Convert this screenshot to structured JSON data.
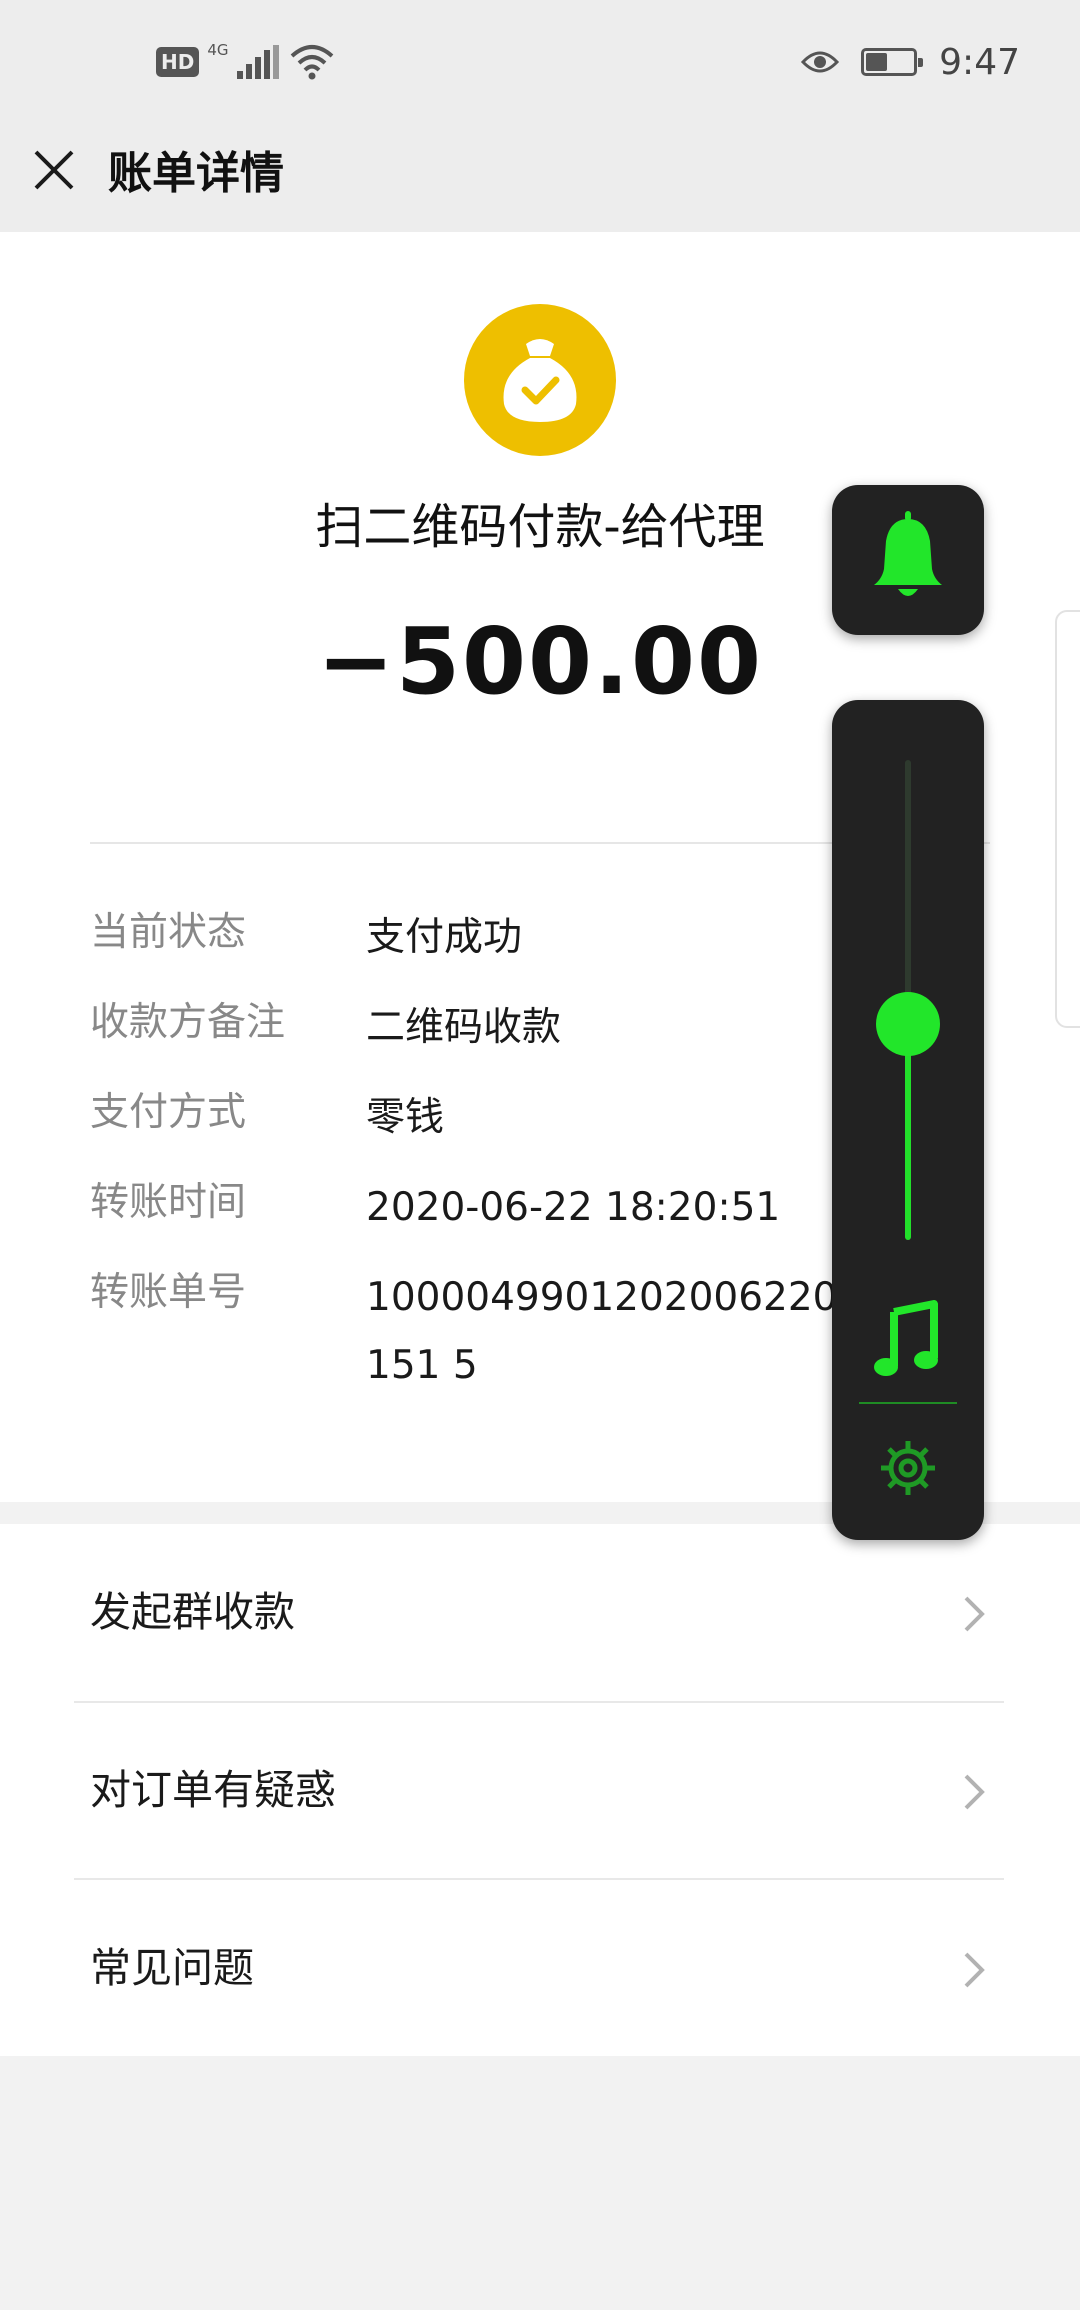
{
  "status_bar": {
    "hd_badge": "HD",
    "network_label": "4G",
    "time": "9:47",
    "battery_level": 0.45,
    "icons": [
      "hd-icon",
      "signal-icon",
      "wifi-icon",
      "eye-icon",
      "battery-icon"
    ]
  },
  "nav": {
    "title": "账单详情",
    "close_icon": "close-icon"
  },
  "bill": {
    "merchant_icon": "money-bag-check-icon",
    "merchant_name": "扫二维码付款-给代理",
    "amount": "−500.00",
    "icon_color": "#eebf00"
  },
  "details": [
    {
      "label": "当前状态",
      "value": "支付成功"
    },
    {
      "label": "收款方备注",
      "value": "二维码收款"
    },
    {
      "label": "支付方式",
      "value": "零钱"
    },
    {
      "label": "转账时间",
      "value": "2020-06-22 18:20:51"
    },
    {
      "label": "转账单号",
      "value": "1000049901202006220109151 5"
    }
  ],
  "menu": [
    {
      "label": "发起群收款"
    },
    {
      "label": "对订单有疑惑"
    },
    {
      "label": "常见问题"
    }
  ],
  "floating_controls": {
    "bell_icon": "bell-icon",
    "volume_level": 0.45,
    "music_icon": "music-note-icon",
    "settings_icon": "gear-icon",
    "accent_color": "#22e62a"
  }
}
